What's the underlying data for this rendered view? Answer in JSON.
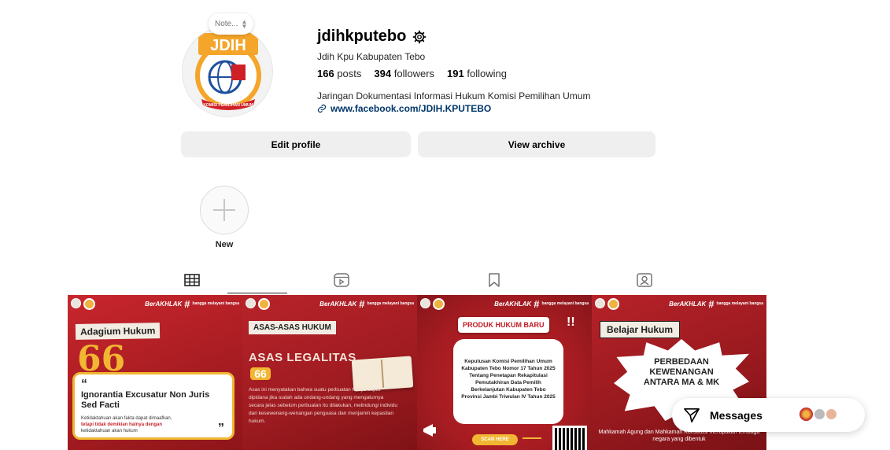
{
  "profile": {
    "username": "jdihkputebo",
    "full_name": "Jdih Kpu Kabupaten Tebo",
    "posts_count": "166",
    "posts_label": "posts",
    "followers_count": "394",
    "followers_label": "followers",
    "following_count": "191",
    "following_label": "following",
    "bio": "Jaringan Dokumentasi Informasi Hukum Komisi Pemilihan Umum",
    "link": "www.facebook.com/JDIH.KPUTEBO",
    "note_placeholder": "Note..."
  },
  "avatar": {
    "logo_text": "JDIH",
    "ribbon_text": "KOMISI PEMILIHAN UMUM"
  },
  "buttons": {
    "edit_profile": "Edit profile",
    "view_archive": "View archive"
  },
  "highlights": {
    "new_label": "New"
  },
  "tabs": [
    {
      "name": "grid-icon",
      "active": true
    },
    {
      "name": "reels-icon",
      "active": false
    },
    {
      "name": "saved-icon",
      "active": false
    },
    {
      "name": "tagged-icon",
      "active": false
    }
  ],
  "posts": [
    {
      "brand": "BerAKHLAK",
      "tagline": "bangga melayani bangsa",
      "title": "Adagium Hukum",
      "quote_mark": "66",
      "headline": "Ignorantia Excusatur Non Juris Sed Facti",
      "text_1": "Ketidaktahuan akan fakta dapat dimaafkan,",
      "text_2": "tetapi tidak demikian halnya dengan",
      "text_3": "ketidaktahuan akan hukum",
      "open_quote": "“",
      "close_quote": "”"
    },
    {
      "brand": "BerAKHLAK",
      "tagline": "bangga melayani bangsa",
      "title": "ASAS-ASAS HUKUM",
      "subtitle": "ASAS LEGALITAS",
      "quote_mark": "66",
      "text": "Asas ini menyatakan bahwa suatu perbuatan hanya dapat dipidana jika sudah ada undang-undang yang mengaturnya secara jelas sebelum perbuatan itu dilakukan, melindungi individu dari kesewenang-wenangan penguasa dan menjamin kepastian hukum."
    },
    {
      "brand": "BerAKHLAK",
      "tagline": "bangga melayani bangsa",
      "badge": "PRODUK HUKUM BARU",
      "bang": "!!",
      "text": "Keputusan Komisi Pemilihan Umum Kabupaten Tebo Nomor 17 Tahun 2025 Tentang Penetapan Rekapitulasi Pemutakhiran Data Pemilih Berkelanjutan Kabupaten Tebo Provinsi Jambi Triwulan IV Tahun 2025",
      "scan": "SCAN HERE"
    },
    {
      "brand": "BerAKHLAK",
      "tagline": "bangga melayani bangsa",
      "title": "Belajar Hukum",
      "burst_1": "PERBEDAAN",
      "burst_2": "KEWENANGAN",
      "burst_3": "ANTARA MA & MK",
      "footer": "Mahkamah Agung dan Mahkamah Konstitusi merupakan lembaga negara yang dibentuk"
    }
  ],
  "messages": {
    "label": "Messages"
  },
  "colors": {
    "post_red": "#c9262d",
    "accent_gold": "#f2b632",
    "link_blue": "#00376b",
    "button_gray": "#efefef"
  }
}
